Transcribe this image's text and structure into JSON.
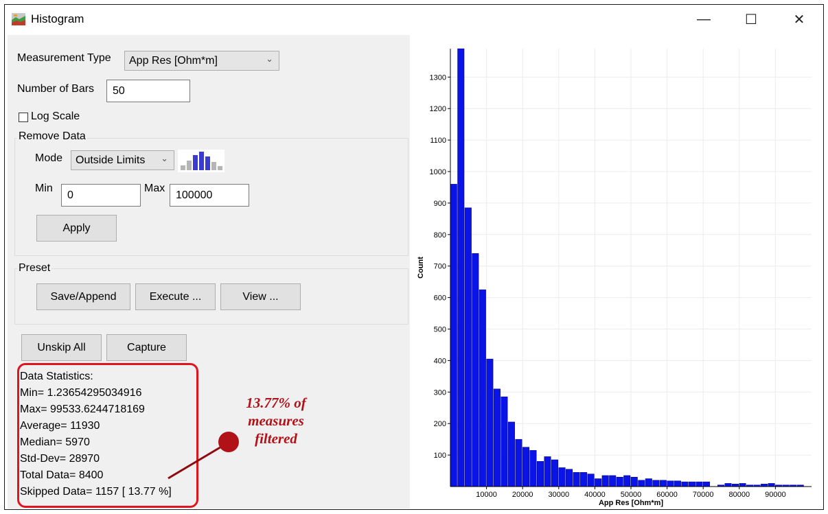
{
  "window": {
    "title": "Histogram",
    "minimize_icon": "minimize-icon",
    "maximize_icon": "maximize-icon",
    "close_icon": "close-icon"
  },
  "controls": {
    "measurement_type_label": "Measurement Type",
    "measurement_type_value": "App Res [Ohm*m]",
    "number_of_bars_label": "Number of Bars",
    "number_of_bars_value": "50",
    "log_scale_label": "Log Scale",
    "log_scale_checked": false
  },
  "remove_data": {
    "group_title": "Remove Data",
    "mode_label": "Mode",
    "mode_value": "Outside Limits",
    "mode_icon": "histogram-filter-icon",
    "min_label": "Min",
    "min_value": "0",
    "max_label": "Max",
    "max_value": "100000",
    "apply_label": "Apply"
  },
  "preset": {
    "group_title": "Preset",
    "save_append_label": "Save/Append",
    "execute_label": "Execute ...",
    "view_label": "View ..."
  },
  "actions": {
    "unskip_all_label": "Unskip All",
    "capture_label": "Capture"
  },
  "statistics": {
    "header": "Data Statistics:",
    "min": "Min= 1.23654295034916",
    "max": "Max= 99533.6244718169",
    "average": "Average= 11930",
    "median": "Median= 5970",
    "std_dev": "Std-Dev= 28970",
    "total": "Total Data= 8400",
    "skipped": "Skipped Data= 1157 [ 13.77 %]"
  },
  "annotation": {
    "line1": "13.77% of",
    "line2": "measures",
    "line3": "filtered",
    "color": "#b01218"
  },
  "colors": {
    "bar": "#0a14e6",
    "highlight": "#e0141e"
  },
  "chart_data": {
    "type": "bar",
    "title": "",
    "xlabel": "App Res [Ohm*m]",
    "ylabel": "Count",
    "bin_width": 2000,
    "xlim": [
      0,
      100000
    ],
    "ylim": [
      0,
      1390
    ],
    "xticks": [
      10000,
      20000,
      30000,
      40000,
      50000,
      60000,
      70000,
      80000,
      90000
    ],
    "xtick_labels": [
      "10000",
      "20000",
      "30000",
      "40000",
      "50000",
      "60000",
      "70000",
      "80000",
      "90000"
    ],
    "yticks": [
      100,
      200,
      300,
      400,
      500,
      600,
      700,
      800,
      900,
      1000,
      1100,
      1200,
      1300
    ],
    "ytick_labels": [
      "100",
      "200",
      "300",
      "400",
      "500",
      "600",
      "700",
      "800",
      "900",
      "1000",
      "1100",
      "1200",
      "1300"
    ],
    "grid": true,
    "legend": "none",
    "values": [
      960,
      1390,
      885,
      740,
      625,
      405,
      310,
      285,
      205,
      150,
      125,
      115,
      80,
      95,
      85,
      60,
      55,
      45,
      45,
      40,
      25,
      35,
      35,
      30,
      35,
      30,
      20,
      25,
      20,
      20,
      18,
      18,
      15,
      15,
      15,
      15,
      0,
      5,
      10,
      8,
      10,
      5,
      5,
      8,
      10,
      5,
      5,
      5,
      5,
      0
    ]
  }
}
